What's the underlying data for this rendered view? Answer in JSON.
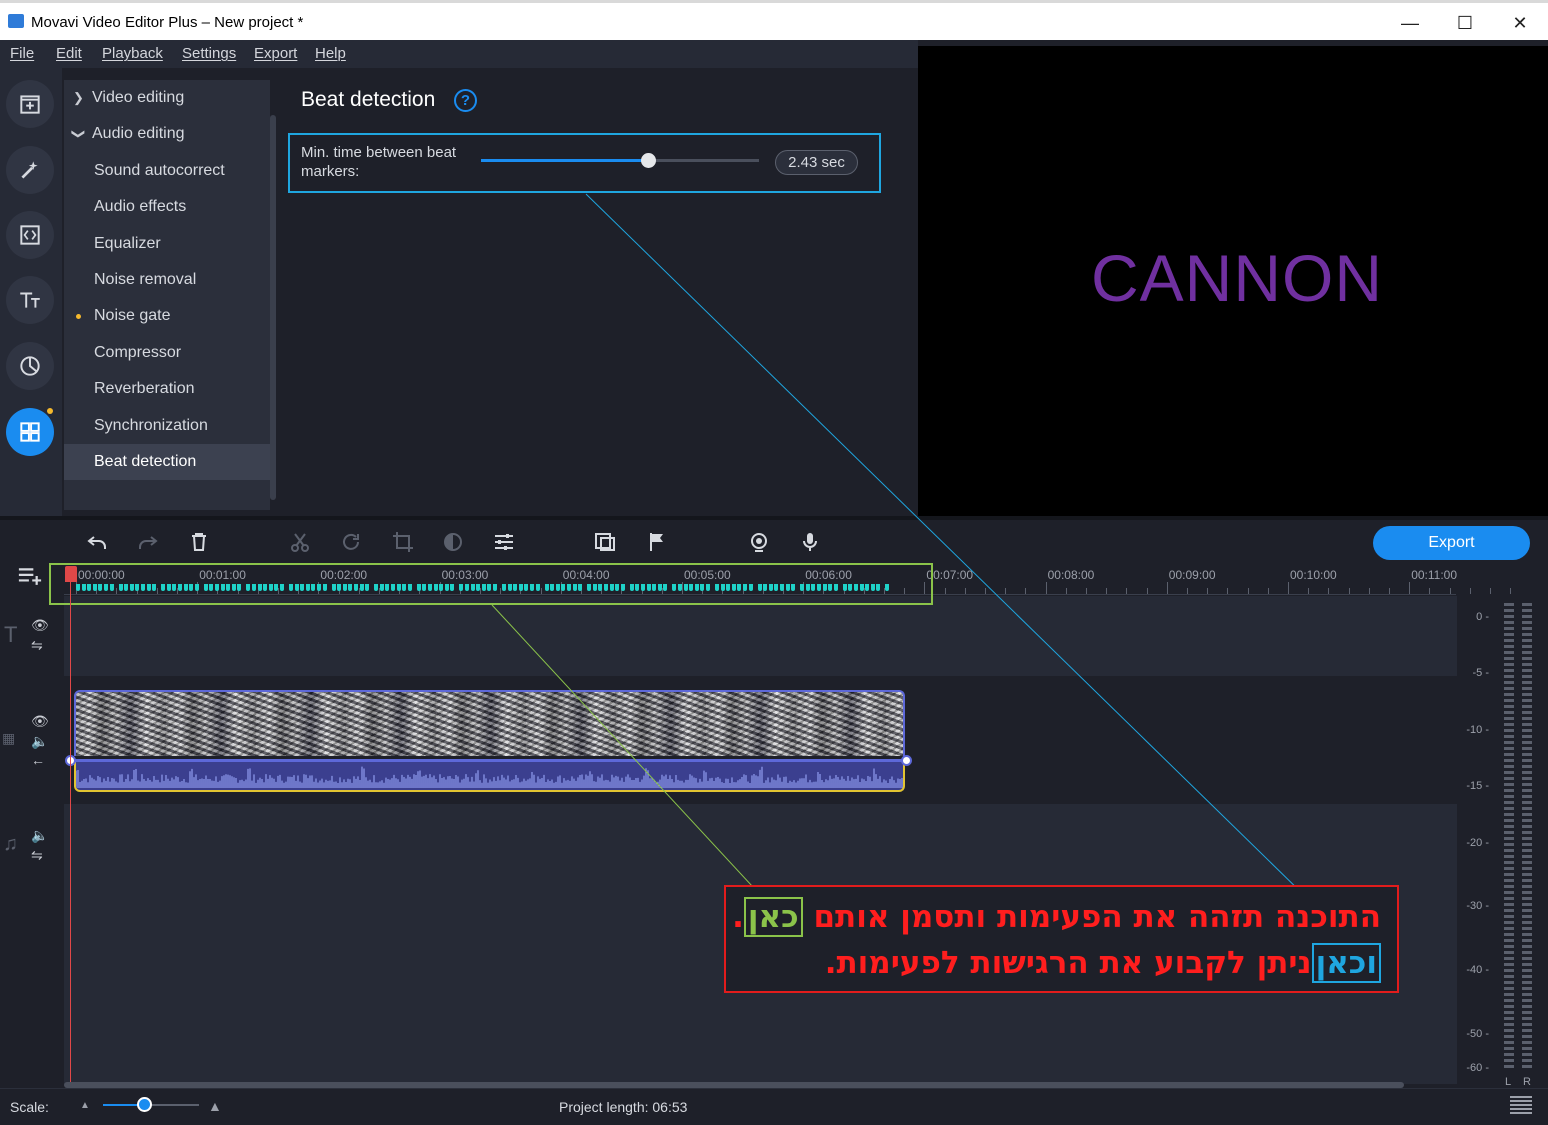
{
  "window": {
    "title": "Movavi Video Editor Plus – New project *",
    "minimize": "—",
    "maximize": "☐",
    "close": "✕"
  },
  "menu": [
    "File",
    "Edit",
    "Playback",
    "Settings",
    "Export",
    "Help"
  ],
  "rail_icons": [
    "import-icon",
    "magic-wand-icon",
    "transitions-icon",
    "titles-icon",
    "filters-icon",
    "more-tools-icon"
  ],
  "nav": {
    "items": [
      {
        "label": "Video editing",
        "type": "collapsed"
      },
      {
        "label": "Audio editing",
        "type": "expanded"
      },
      {
        "label": "Sound autocorrect",
        "type": "child"
      },
      {
        "label": "Audio effects",
        "type": "child"
      },
      {
        "label": "Equalizer",
        "type": "child"
      },
      {
        "label": "Noise removal",
        "type": "child"
      },
      {
        "label": "Noise gate",
        "type": "child-dot"
      },
      {
        "label": "Compressor",
        "type": "child"
      },
      {
        "label": "Reverberation",
        "type": "child"
      },
      {
        "label": "Synchronization",
        "type": "child"
      },
      {
        "label": "Beat detection",
        "type": "child-selected"
      }
    ]
  },
  "panel": {
    "title": "Beat detection",
    "help": "?",
    "setting_label": "Min. time between beat markers:",
    "slider_value": 0.6,
    "value_text": "2.43 sec"
  },
  "preview": {
    "text": "CANNON",
    "text_color": "#7030a0"
  },
  "toolbar": {
    "icons": [
      "undo-icon",
      "redo-icon",
      "delete-icon",
      "cut-icon",
      "rotate-icon",
      "crop-icon",
      "color-adjust-icon",
      "clip-properties-icon",
      "overlay-icon",
      "marker-flag-icon",
      "record-screen-icon",
      "microphone-icon"
    ],
    "export_label": "Export"
  },
  "ruler": {
    "ticks": [
      "00:00:00",
      "00:01:00",
      "00:02:00",
      "00:03:00",
      "00:04:00",
      "00:05:00",
      "00:06:00",
      "00:07:00",
      "00:08:00",
      "00:09:00",
      "00:10:00",
      "00:11:00"
    ]
  },
  "vu_meter": {
    "labels": [
      "0",
      "-5",
      "-10",
      "-15",
      "-20",
      "-30",
      "-40",
      "-50",
      "-60"
    ],
    "left": "L",
    "right": "R"
  },
  "status": {
    "scale_label": "Scale:",
    "project_length": "Project length:  06:53"
  },
  "annotation": {
    "line1_text": "התוכנה תזהה את הפעימות ותסמן אותם ",
    "line1_highlight": "כאן",
    "line1_end": ".",
    "line2_highlight": "וכאן",
    "line2_text": "ניתן לקבוע את הרגישות לפעימות.",
    "box_color": "#e21c1c",
    "beats_color": "#8bc34a",
    "setting_color": "#1fa6e0"
  },
  "colors": {
    "accent": "#1a8cf0",
    "beat_marker": "#1fd2c8",
    "playhead": "#e04848"
  }
}
